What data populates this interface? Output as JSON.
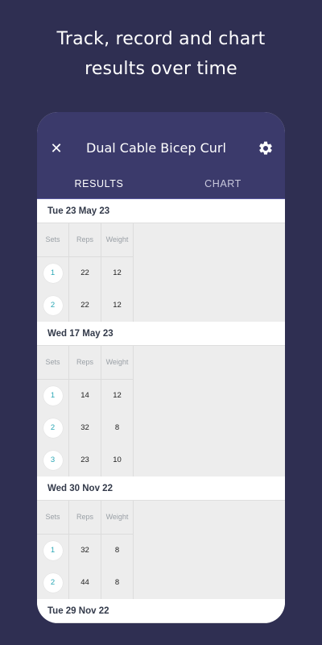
{
  "headline": {
    "line1": "Track, record and chart",
    "line2": "results over time"
  },
  "appbar": {
    "title": "Dual Cable Bicep Curl",
    "close_icon": "close-icon",
    "settings_icon": "gear-icon"
  },
  "tabs": [
    {
      "label": "RESULTS",
      "active": true
    },
    {
      "label": "CHART",
      "active": false
    }
  ],
  "columns": {
    "sets": "Sets",
    "reps": "Reps",
    "weight": "Weight"
  },
  "sessions": [
    {
      "date": "Tue 23 May 23",
      "sets": [
        {
          "n": "1",
          "reps": "22",
          "weight": "12"
        },
        {
          "n": "2",
          "reps": "22",
          "weight": "12"
        }
      ]
    },
    {
      "date": "Wed 17 May 23",
      "sets": [
        {
          "n": "1",
          "reps": "14",
          "weight": "12"
        },
        {
          "n": "2",
          "reps": "32",
          "weight": "8"
        },
        {
          "n": "3",
          "reps": "23",
          "weight": "10"
        }
      ]
    },
    {
      "date": "Wed 30 Nov 22",
      "sets": [
        {
          "n": "1",
          "reps": "32",
          "weight": "8"
        },
        {
          "n": "2",
          "reps": "44",
          "weight": "8"
        }
      ]
    },
    {
      "date": "Tue 29 Nov 22",
      "sets": []
    }
  ],
  "colors": {
    "background": "#2f2f52",
    "appbar": "#3b3a6b",
    "accent": "#2aa7b5"
  }
}
